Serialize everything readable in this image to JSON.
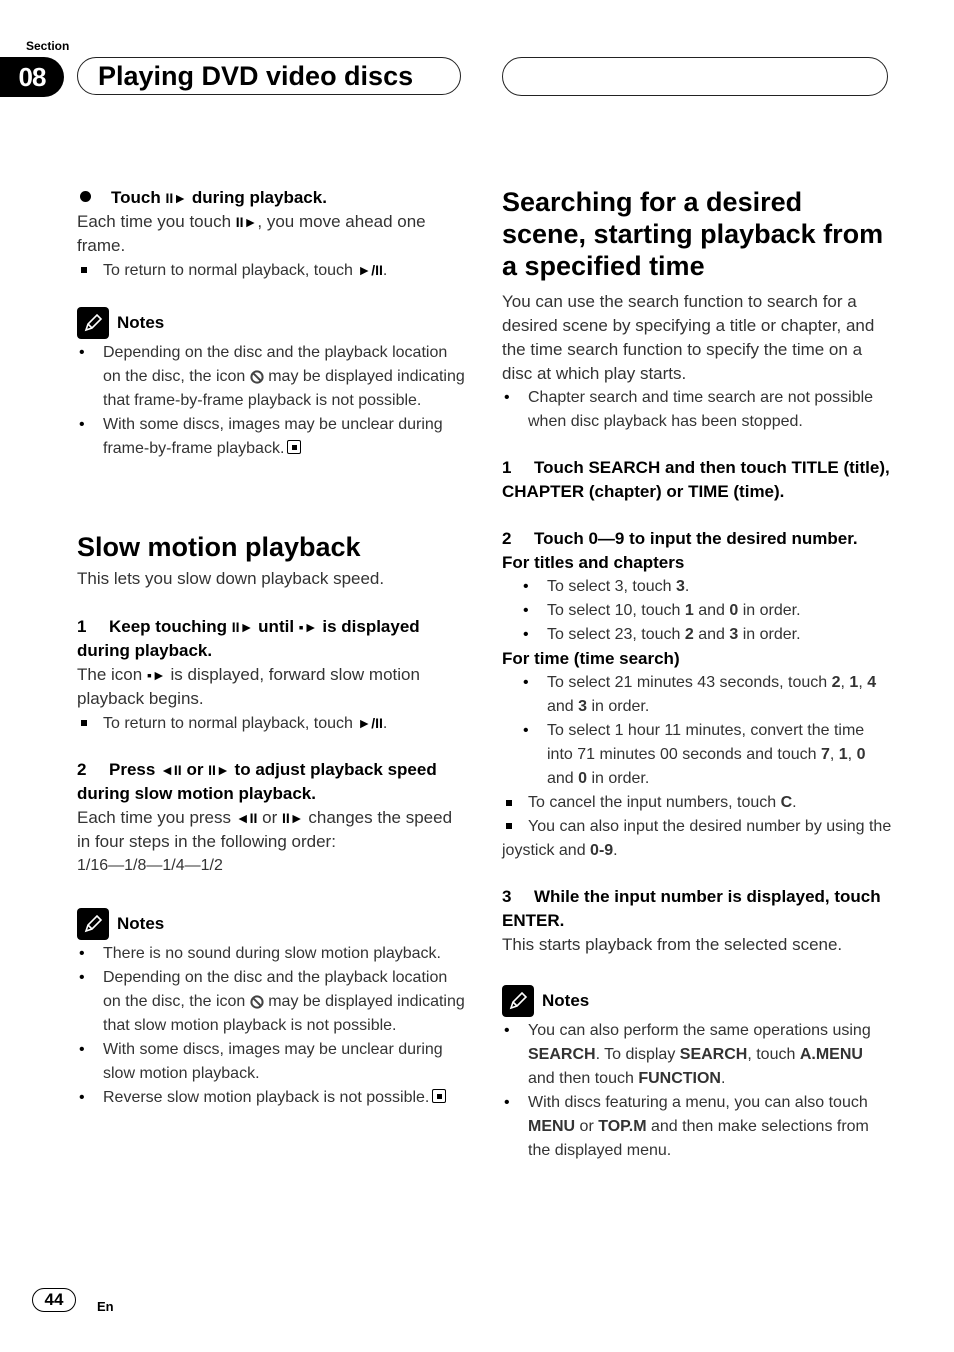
{
  "header": {
    "section_label": "Section",
    "section_number": "08",
    "chapter_title": "Playing DVD video discs"
  },
  "left": {
    "intro_step": {
      "title_pre": "Touch",
      "title_glyph": "II►",
      "title_post": "during playback.",
      "body_pre": "Each time you touch",
      "body_glyph": "II►",
      "body_post": ", you move ahead one frame.",
      "note_pre": "To return to normal playback, touch",
      "note_glyph": "►/II",
      "note_post": "."
    },
    "notes1": {
      "label": "Notes",
      "items": [
        {
          "pre": "Depending on the disc and the playback location on the disc, the icon",
          "post": "may be displayed indicating that frame-by-frame playback is not possible."
        },
        {
          "pre": "With some discs, images may be unclear during frame-by-frame playback.",
          "post": ""
        }
      ]
    },
    "slow": {
      "heading": "Slow motion playback",
      "intro": "This lets you slow down playback speed.",
      "step1": {
        "num": "1",
        "pre": "Keep touching",
        "glyph1": "II►",
        "mid": "until",
        "glyph2": "▪►",
        "post": "is displayed during playback.",
        "body_pre": "The icon",
        "body_glyph": "▪►",
        "body_post": "is displayed, forward slow motion playback begins.",
        "note_pre": "To return to normal playback, touch",
        "note_glyph": "►/II",
        "note_post": "."
      },
      "step2": {
        "num": "2",
        "pre": "Press",
        "glyph1": "◄II",
        "mid": "or",
        "glyph2": "II►",
        "post": "to adjust playback speed during slow motion playback.",
        "body_pre": "Each time you press",
        "body_glyph1": "◄II",
        "body_mid": "or",
        "body_glyph2": "II►",
        "body_post": "changes the speed in four steps in the following order:",
        "order": "1/16—1/8—1/4—1/2"
      }
    },
    "notes2": {
      "label": "Notes",
      "items": [
        {
          "text": "There is no sound during slow motion playback."
        },
        {
          "pre": "Depending on the disc and the playback location on the disc, the icon",
          "post": "may be displayed indicating that slow motion playback is not possible."
        },
        {
          "text": "With some discs, images may be unclear during slow motion playback."
        },
        {
          "text": "Reverse slow motion playback is not possible."
        }
      ]
    }
  },
  "right": {
    "heading": "Searching for a desired scene, starting playback from a specified time",
    "intro": "You can use the search function to search for a desired scene by specifying a title or chapter, and the time search function to specify the time on a disc at which play starts.",
    "intro_bullet": "Chapter search and time search are not possible when disc playback has been stopped.",
    "step1": {
      "num": "1",
      "text": "Touch SEARCH and then touch TITLE (title), CHAPTER (chapter) or TIME (time)."
    },
    "step2": {
      "num": "2",
      "text": "Touch 0—9 to input the desired number."
    },
    "titles_heading": "For titles and chapters",
    "titles": [
      {
        "a": "To select 3, touch ",
        "b1": "3",
        "c": ".",
        "b2": "",
        "d": ""
      },
      {
        "a": "To select 10, touch ",
        "b1": "1",
        "c": " and ",
        "b2": "0",
        "d": " in order."
      },
      {
        "a": "To select 23, touch ",
        "b1": "2",
        "c": " and ",
        "b2": "3",
        "d": " in order."
      }
    ],
    "time_heading": "For time (time search)",
    "time_items": [
      {
        "a": "To select 21 minutes 43 seconds, touch ",
        "b1": "2",
        "s1": ", ",
        "b2": "1",
        "s2": ", ",
        "b3": "4",
        "s3": " and ",
        "b4": "3",
        "end": " in order."
      },
      {
        "a": "To select 1 hour 11 minutes, convert the time into 71 minutes 00 seconds and touch ",
        "b1": "7",
        "s1": ", ",
        "b2": "1",
        "s2": ", ",
        "b3": "0",
        "s3": " and ",
        "b4": "0",
        "end": " in order."
      }
    ],
    "cancel": {
      "a": "To cancel the input numbers, touch ",
      "b": "C",
      "c": "."
    },
    "joystick": {
      "a": "You can also input the desired number by using the joystick and ",
      "b": "0-9",
      "c": "."
    },
    "step3": {
      "num": "3",
      "text": "While the input number is displayed, touch ENTER.",
      "body": "This starts playback from the selected scene."
    },
    "notes": {
      "label": "Notes",
      "item1": {
        "a": "You can also perform the same operations using ",
        "b1": "SEARCH",
        "c": ". To display ",
        "b2": "SEARCH",
        "d": ", touch ",
        "b3": "A.MENU",
        "e": " and then touch ",
        "b4": "FUNCTION",
        "f": "."
      },
      "item2": {
        "a": "With discs featuring a menu, you can also touch ",
        "b1": "MENU",
        "c": " or ",
        "b2": "TOP.M",
        "d": " and then make selections from the displayed menu."
      }
    }
  },
  "footer": {
    "page_number": "44",
    "language": "En"
  }
}
